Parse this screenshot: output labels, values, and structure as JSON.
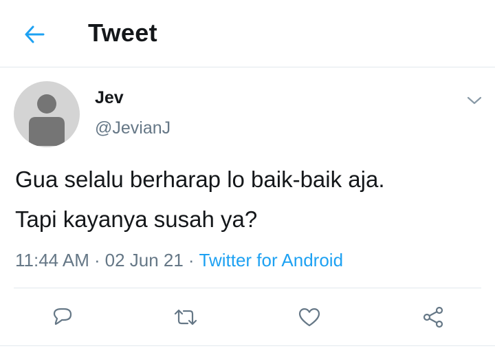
{
  "header": {
    "title": "Tweet",
    "back_icon": "arrow-left-icon"
  },
  "colors": {
    "accent": "#1da1f2",
    "secondary_text": "#657786",
    "primary_text": "#14171a",
    "divider": "#e1e8ed"
  },
  "tweet": {
    "author_name": "Jev",
    "author_handle": "@JevianJ",
    "text_line1": "Gua selalu berharap lo baik-baik aja.",
    "text_line2": "Tapi kayanya susah ya?",
    "time": "11:44 AM",
    "separator": "·",
    "date": "02 Jun 21",
    "source": "Twitter for Android"
  },
  "actions": [
    {
      "name": "reply",
      "icon": "reply-icon"
    },
    {
      "name": "retweet",
      "icon": "retweet-icon"
    },
    {
      "name": "like",
      "icon": "heart-icon"
    },
    {
      "name": "share",
      "icon": "share-icon"
    }
  ]
}
